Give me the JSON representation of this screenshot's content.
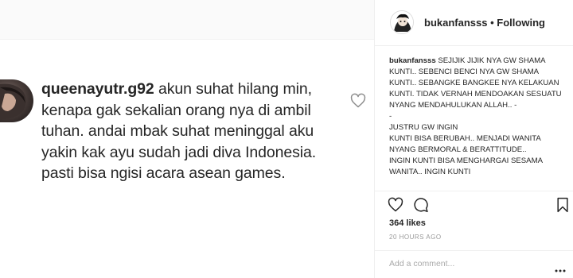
{
  "image": {
    "comment": {
      "username": "queenayutr.g92",
      "text": " akun suhat  hilang min, kenapa gak sekalian orang nya di ambil tuhan. andai mbak suhat meninggal aku yakin kak ayu sudah jadi diva Indonesia. pasti bisa ngisi acara asean games."
    },
    "heart_icon": "heart-outline-icon"
  },
  "header": {
    "username": "bukanfansss",
    "separator": "•",
    "follow_status": "Following"
  },
  "caption": {
    "username": "bukanfansss",
    "text": " SEJIJIK JIJIK NYA GW SHAMA KUNTI.. SEBENCI BENCI NYA GW SHAMA KUNTI.. SEBANGKE BANGKEE NYA KELAKUAN KUNTI. TIDAK VERNAH MENDOAKAN SESUATU NYANG MENDAHULUKAN ALLAH.. -\n-\nJUSTRU GW INGIN\nKUNTI BISA BERUBAH.. MENJADI WANITA NYANG BERMORAL & BERATTITUDE..\nINGIN KUNTI BISA MENGHARGAI SESAMA WANITA.. INGIN KUNTI"
  },
  "actions": {
    "like_icon": "heart-outline-icon",
    "comment_icon": "comment-bubble-icon",
    "save_icon": "bookmark-icon"
  },
  "likes": "364 likes",
  "timestamp": "20 HOURS AGO",
  "add_comment": {
    "placeholder": "Add a comment..."
  },
  "colors": {
    "text": "#262626",
    "muted": "#999999",
    "border": "#efefef"
  }
}
